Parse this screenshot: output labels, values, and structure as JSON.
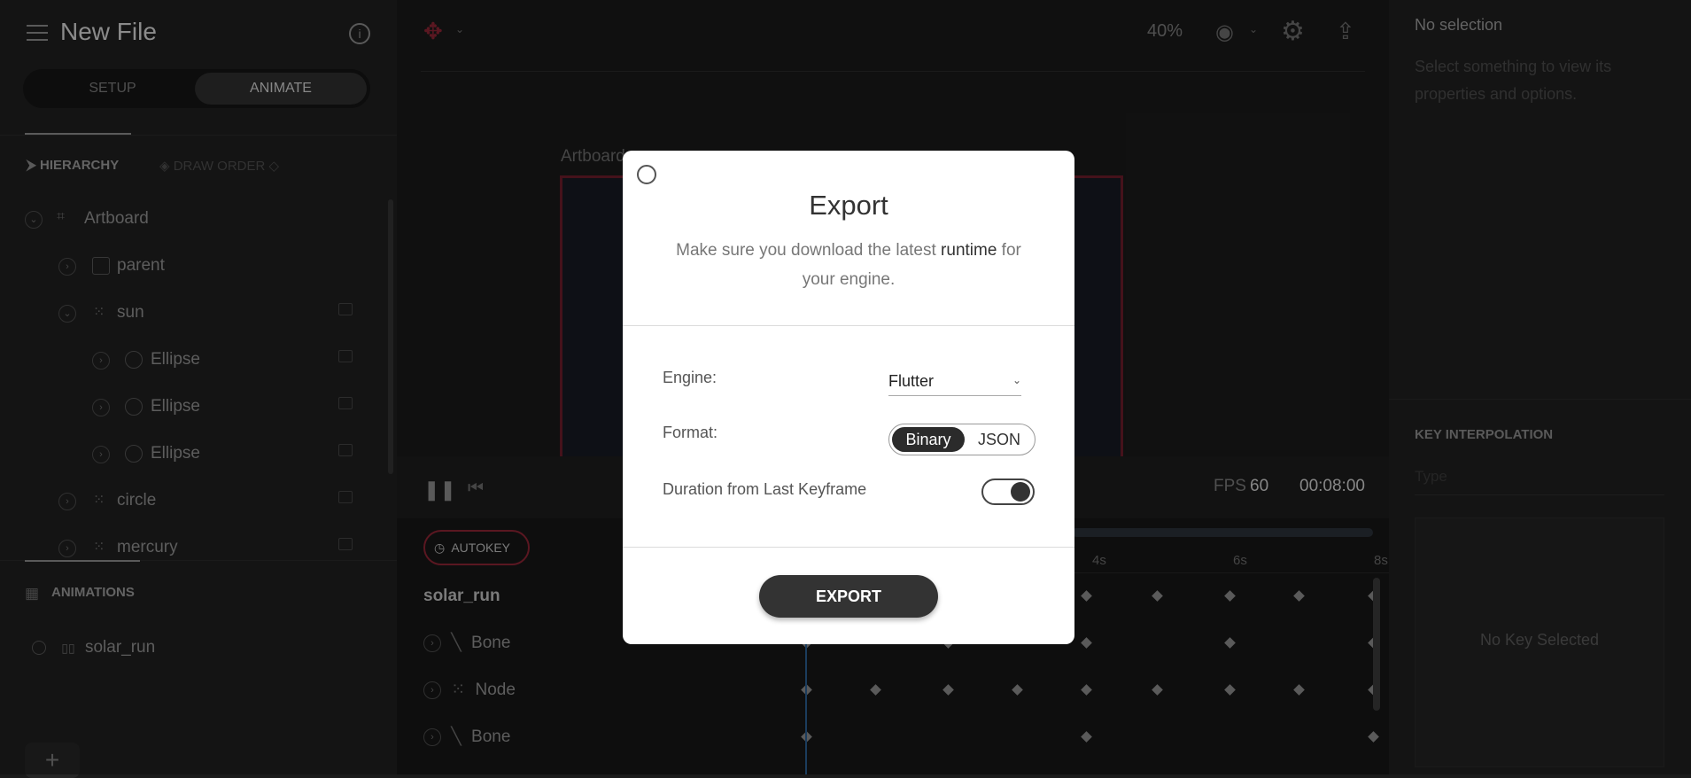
{
  "file": {
    "title": "New File"
  },
  "modes": {
    "setup": "SETUP",
    "animate": "ANIMATE"
  },
  "hierarchy_tabs": {
    "hierarchy": "HIERARCHY",
    "draw_order": "DRAW ORDER"
  },
  "tree": [
    {
      "label": "Artboard"
    },
    {
      "label": "parent"
    },
    {
      "label": "sun"
    },
    {
      "label": "Ellipse"
    },
    {
      "label": "Ellipse"
    },
    {
      "label": "Ellipse"
    },
    {
      "label": "circle"
    },
    {
      "label": "mercury"
    }
  ],
  "animations": {
    "title": "ANIMATIONS",
    "items": [
      {
        "label": "solar_run"
      }
    ],
    "add_label": "+"
  },
  "toolbar": {
    "zoom": "40%"
  },
  "stage": {
    "artboard_label": "Artboard"
  },
  "playback": {
    "fps_label": "FPS",
    "fps_value": "60",
    "duration": "00:08:00"
  },
  "timeline": {
    "autokey": "AUTOKEY",
    "ticks": [
      "4s",
      "6s",
      "8s"
    ],
    "tracks": [
      {
        "label": "solar_run"
      },
      {
        "label": "Bone"
      },
      {
        "label": "Node"
      },
      {
        "label": "Bone"
      }
    ]
  },
  "inspector": {
    "title": "No selection",
    "description": "Select something to view its properties and options.",
    "key_interpolation": "KEY INTERPOLATION",
    "type_placeholder": "Type",
    "no_key": "No Key Selected"
  },
  "modal": {
    "title": "Export",
    "desc_pre": "Make sure you download the latest ",
    "desc_link": "runtime",
    "desc_post": " for your engine.",
    "engine_label": "Engine:",
    "engine_value": "Flutter",
    "format_label": "Format:",
    "format_options": [
      "Binary",
      "JSON"
    ],
    "format_selected": "Binary",
    "duration_label": "Duration from Last Keyframe",
    "duration_toggle": true,
    "export_button": "EXPORT"
  },
  "colors": {
    "accent_red": "#8b2434",
    "playhead_blue": "#2a5d8f"
  }
}
